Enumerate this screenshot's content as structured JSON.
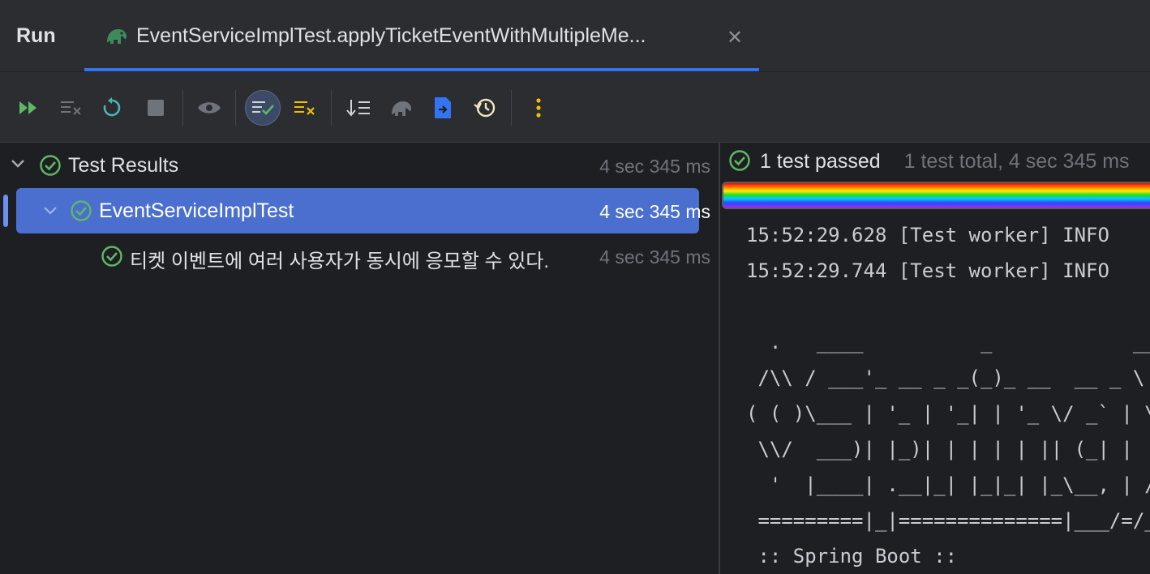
{
  "tabbar": {
    "run_label": "Run",
    "tab_title": "EventServiceImplTest.applyTicketEventWithMultipleMe...",
    "tab_icon": "gradle-elephant-icon",
    "close_icon": "close-icon"
  },
  "toolbar": {
    "buttons": [
      "rerun-failed-icon",
      "clear-icon",
      "rerun-icon",
      "stop-icon",
      "eye-icon",
      "show-passed-icon",
      "show-ignored-icon",
      "sort-icon",
      "gradle-icon",
      "export-icon",
      "history-icon",
      "more-icon"
    ]
  },
  "tree": {
    "root_label": "Test Results",
    "root_duration": "4 sec 345 ms",
    "class_label": "EventServiceImplTest",
    "class_duration": "4 sec 345 ms",
    "test_label": "티켓 이벤트에 여러 사용자가 동시에 응모할 수 있다.",
    "test_duration": "4 sec 345 ms"
  },
  "status": {
    "passed": "1 test passed",
    "summary": "1 test total, 4 sec 345 ms"
  },
  "console": {
    "lines": [
      "15:52:29.628 [Test worker] INFO",
      "15:52:29.744 [Test worker] INFO",
      "",
      "  .   ____          _            __ _ _",
      " /\\\\ / ___'_ __ _ _(_)_ __  __ _ \\ \\ \\ \\",
      "( ( )\\___ | '_ | '_| | '_ \\/ _` | \\ \\ \\ \\",
      " \\\\/  ___)| |_)| | | | | || (_| |  ) ) ) )",
      "  '  |____| .__|_| |_|_| |_\\__, | / / / /",
      " =========|_|==============|___/=/_/_/_/",
      " :: Spring Boot ::"
    ]
  },
  "colors": {
    "accent": "#3574f0",
    "selection": "#4a6fcf",
    "passed_green": "#5fb865"
  }
}
